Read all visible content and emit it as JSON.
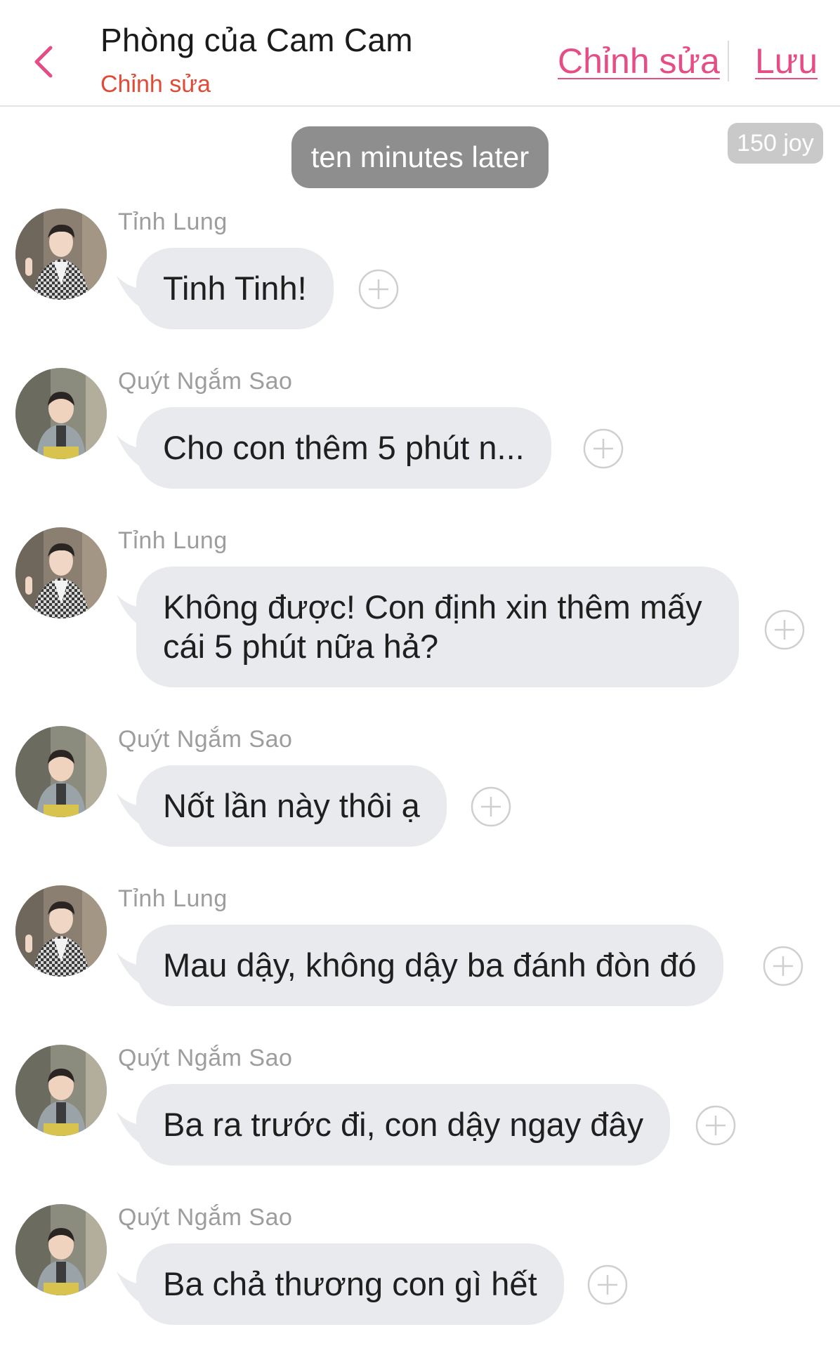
{
  "header": {
    "title": "Phòng của Cam Cam",
    "subtitle": "Chỉnh sửa",
    "edit_label": "Chỉnh sửa",
    "save_label": "Lưu"
  },
  "time_marker": "ten minutes later",
  "joy_badge": "150 joy",
  "messages": [
    {
      "sender": "Tỉnh Lung",
      "text": "Tinh Tinh!"
    },
    {
      "sender": "Quýt Ngắm Sao",
      "text": "Cho con thêm 5 phút n..."
    },
    {
      "sender": "Tỉnh Lung",
      "text": "Không được! Con định xin thêm mấy cái 5 phút nữa hả?"
    },
    {
      "sender": "Quýt Ngắm Sao",
      "text": "Nốt lần này thôi ạ"
    },
    {
      "sender": "Tỉnh Lung",
      "text": "Mau dậy, không dậy ba đánh đòn đó"
    },
    {
      "sender": "Quýt Ngắm Sao",
      "text": "Ba ra trước đi, con dậy ngay đây"
    },
    {
      "sender": "Quýt Ngắm Sao",
      "text": "Ba chả thương con gì hết"
    }
  ],
  "colors": {
    "accent": "#e64d86",
    "subtitle": "#e34a36",
    "bubble": "#e9eaed",
    "pill": "#8e8e8e"
  },
  "icons": {
    "back": "chevron-left-icon",
    "add": "plus-circle-icon"
  }
}
